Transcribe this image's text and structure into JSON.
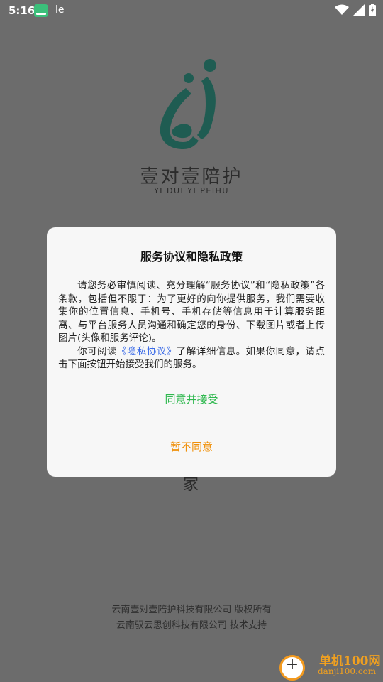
{
  "status_bar": {
    "time": "5:16",
    "sim_indicator": "le",
    "icons": [
      "app-notification-icon",
      "wifi-icon",
      "signal-icon",
      "battery-icon"
    ]
  },
  "brand": {
    "name_cn": "壹对壹陪护",
    "name_pinyin": "YI DUI YI PEIHU",
    "logo_color": "#1f7a6a"
  },
  "background_glyph": "家",
  "dialog": {
    "title": "服务协议和隐私政策",
    "paragraph1": "请您务必审慎阅读、充分理解“服务协议”和“隐私政策”各条款，包括但不限于：为了更好的向你提供服务，我们需要收集你的位置信息、手机号、手机存储等信息用于计算服务距离、与平台服务人员沟通和确定您的身份、下载图片或者上传图片(头像和服务评论)。",
    "paragraph2_prefix": "你可阅读",
    "paragraph2_link": "《隐私协议》",
    "paragraph2_suffix": "了解详细信息。如果你同意，请点击下面按钮开始接受我们的服务。",
    "agree_label": "同意并接受",
    "decline_label": "暂不同意",
    "colors": {
      "agree": "#2eb84e",
      "decline": "#f0900a",
      "link": "#3b6be8"
    }
  },
  "footer": {
    "line1": "云南壹对壹陪护科技有限公司  版权所有",
    "line2": "云南驭云思创科技有限公司  技术支持"
  },
  "watermark": {
    "title": "单机100网",
    "url": "danji100.com"
  }
}
